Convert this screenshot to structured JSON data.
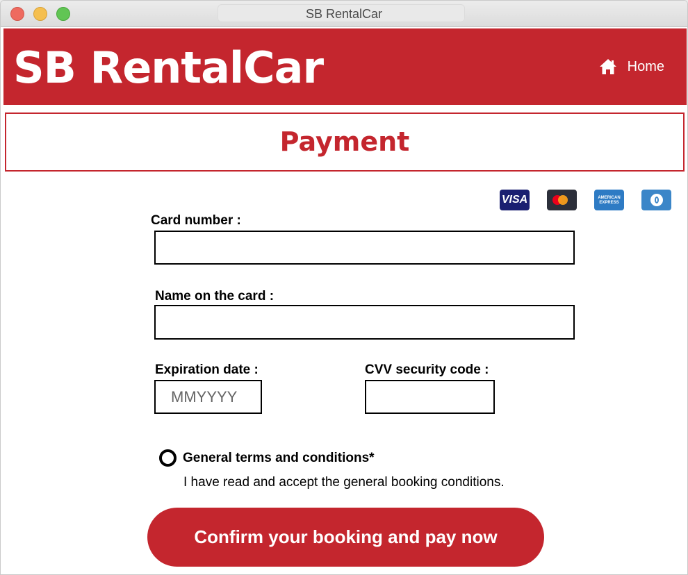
{
  "window": {
    "title": "SB RentalCar"
  },
  "header": {
    "brand": "SB RentalCar",
    "home_label": "Home",
    "home_icon": "home-icon",
    "bg_color": "#c4262e"
  },
  "page": {
    "title": "Payment"
  },
  "card_brands": [
    {
      "name": "visa-icon",
      "label": "VISA"
    },
    {
      "name": "mastercard-icon"
    },
    {
      "name": "amex-icon",
      "label": "AMERICAN EXPRESS"
    },
    {
      "name": "diners-icon"
    }
  ],
  "form": {
    "card_number": {
      "label": "Card number :",
      "value": "",
      "placeholder": ""
    },
    "name_on_card": {
      "label": "Name on the card :",
      "value": "",
      "placeholder": ""
    },
    "expiration": {
      "label": "Expiration date :",
      "value": "",
      "placeholder": "MMYYYY"
    },
    "cvv": {
      "label": "CVV security code :",
      "value": "",
      "placeholder": ""
    },
    "terms": {
      "title": "General terms and conditions*",
      "text": "I have read and accept the general booking conditions.",
      "checked": false
    },
    "submit_label": "Confirm your booking and pay now"
  }
}
